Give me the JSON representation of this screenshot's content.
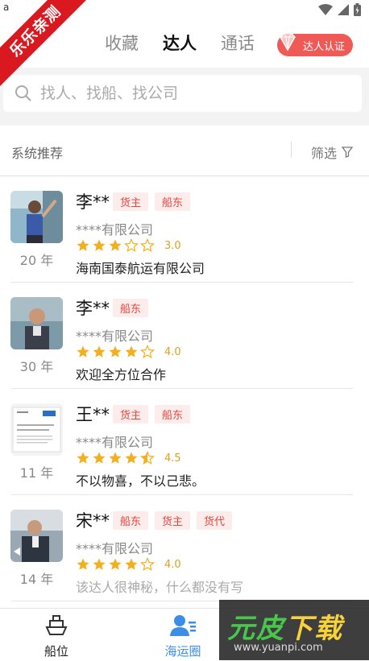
{
  "status": {
    "left_glyph": "a"
  },
  "ribbon": {
    "text": "乐乐亲测"
  },
  "tabs": [
    {
      "label": "收藏",
      "active": false
    },
    {
      "label": "达人",
      "active": true
    },
    {
      "label": "通话",
      "active": false
    }
  ],
  "cert_button": {
    "label": "达人认证"
  },
  "search": {
    "placeholder": "找人、找船、找公司"
  },
  "filter": {
    "left_label": "系统推荐",
    "right_label": "筛选"
  },
  "experts": [
    {
      "name": "李**",
      "tags": [
        "货主",
        "船东"
      ],
      "company": "****有限公司",
      "rating": 3.0,
      "score": "3.0",
      "years": "20 年",
      "desc": "海南国泰航运有限公司",
      "desc_muted": false
    },
    {
      "name": "李**",
      "tags": [
        "船东"
      ],
      "company": "****有限公司",
      "rating": 4.0,
      "score": "4.0",
      "years": "30 年",
      "desc": "欢迎全方位合作",
      "desc_muted": false
    },
    {
      "name": "王**",
      "tags": [
        "货主",
        "船东"
      ],
      "company": "****有限公司",
      "rating": 4.5,
      "score": "4.5",
      "years": "11 年",
      "desc": "不以物喜，不以己悲。",
      "desc_muted": false
    },
    {
      "name": "宋**",
      "tags": [
        "船东",
        "货主",
        "货代"
      ],
      "company": "****有限公司",
      "rating": 4.0,
      "score": "4.0",
      "years": "14 年",
      "desc": "该达人很神秘，什么都没有写",
      "desc_muted": true
    }
  ],
  "bottom_nav": [
    {
      "label": "船位",
      "icon": "ship-icon",
      "active": false
    },
    {
      "label": "海运圈",
      "icon": "contacts-icon",
      "active": true
    }
  ],
  "watermark": {
    "title_a": "元皮",
    "title_b": "下载",
    "url": "www.yuanpi.com"
  },
  "colors": {
    "accent": "#3a8ee6",
    "star": "#f2b01e",
    "badge_bg": "#fdecec",
    "badge_text": "#e2473d",
    "ribbon": "#d9191f"
  }
}
